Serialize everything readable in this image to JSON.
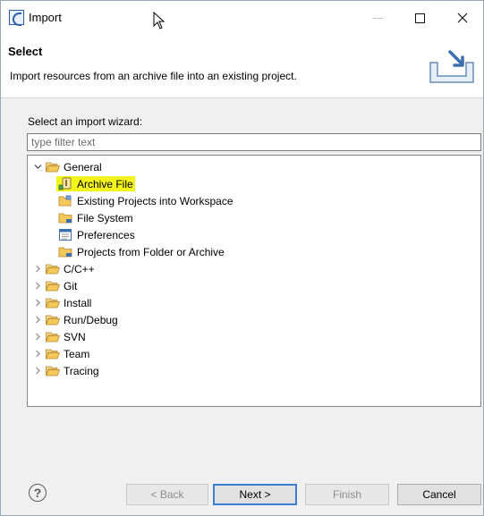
{
  "window": {
    "title": "Import"
  },
  "header": {
    "title": "Select",
    "description": "Import resources from an archive file into an existing project."
  },
  "wizard": {
    "label": "Select an import wizard:",
    "filter_placeholder": "type filter text",
    "filter_value": ""
  },
  "tree": {
    "general": {
      "label": "General",
      "expanded": true,
      "children": [
        {
          "label": "Archive File",
          "icon": "archive-file-icon",
          "selected": true
        },
        {
          "label": "Existing Projects into Workspace",
          "icon": "existing-projects-icon"
        },
        {
          "label": "File System",
          "icon": "folder-icon"
        },
        {
          "label": "Preferences",
          "icon": "preferences-icon"
        },
        {
          "label": "Projects from Folder or Archive",
          "icon": "folder-icon"
        }
      ]
    },
    "collapsed": [
      {
        "label": "C/C++"
      },
      {
        "label": "Git"
      },
      {
        "label": "Install"
      },
      {
        "label": "Run/Debug"
      },
      {
        "label": "SVN"
      },
      {
        "label": "Team"
      },
      {
        "label": "Tracing"
      }
    ]
  },
  "buttons": {
    "back": "< Back",
    "next": "Next >",
    "finish": "Finish",
    "cancel": "Cancel"
  },
  "colors": {
    "selection_highlight": "#f3f51c",
    "folder": "#e8b84a",
    "default_button_border": "#3c7fd0"
  }
}
